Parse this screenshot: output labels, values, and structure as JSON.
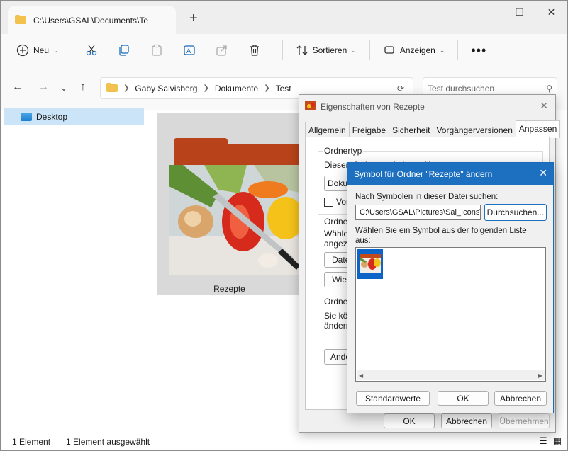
{
  "explorer": {
    "tab_title": "C:\\Users\\GSAL\\Documents\\Te",
    "toolbar": {
      "new_label": "Neu",
      "sort_label": "Sortieren",
      "view_label": "Anzeigen"
    },
    "breadcrumb": [
      "Gaby Salvisberg",
      "Dokumente",
      "Test"
    ],
    "search_placeholder": "Test durchsuchen",
    "sidebar_selected": "Desktop",
    "folder_name": "Rezepte",
    "status": {
      "count": "1 Element",
      "selected": "1 Element ausgewählt"
    }
  },
  "properties_dialog": {
    "title": "Eigenschaften von Rezepte",
    "tabs": [
      "Allgemein",
      "Freigabe",
      "Sicherheit",
      "Vorgängerversionen",
      "Anpassen"
    ],
    "active_tab": "Anpassen",
    "group1_title": "Ordnertyp",
    "group1_text": "Diesen Ordner optimieren für:",
    "group1_select": "Dokum",
    "group1_checkbox": "Vorla",
    "group2_title": "Ordnerb",
    "group2_text1": "Wählen",
    "group2_text2": "angezei",
    "group2_btn1": "Datei",
    "group2_btn2": "Wied",
    "group3_title": "Ordners",
    "group3_text1": "Sie kön",
    "group3_text2": "ändern,",
    "group3_btn": "Ander",
    "ok": "OK",
    "cancel": "Abbrechen",
    "apply": "Übernehmen"
  },
  "icon_dialog": {
    "title": "Symbol für Ordner \"Rezepte\" ändern",
    "search_label": "Nach Symbolen in dieser Datei suchen:",
    "path_value": "C:\\Users\\GSAL\\Pictures\\Sal_Icons\\",
    "browse_label": "Durchsuchen...",
    "list_label_1": "Wählen Sie ein Symbol aus der folgenden Liste",
    "list_label_2": "aus:",
    "standard_label": "Standardwerte",
    "ok_label": "OK",
    "cancel_label": "Abbrechen"
  },
  "colors": {
    "selection": "#cce4f7",
    "accent": "#1d6fbf",
    "folder": "#b8431a"
  }
}
